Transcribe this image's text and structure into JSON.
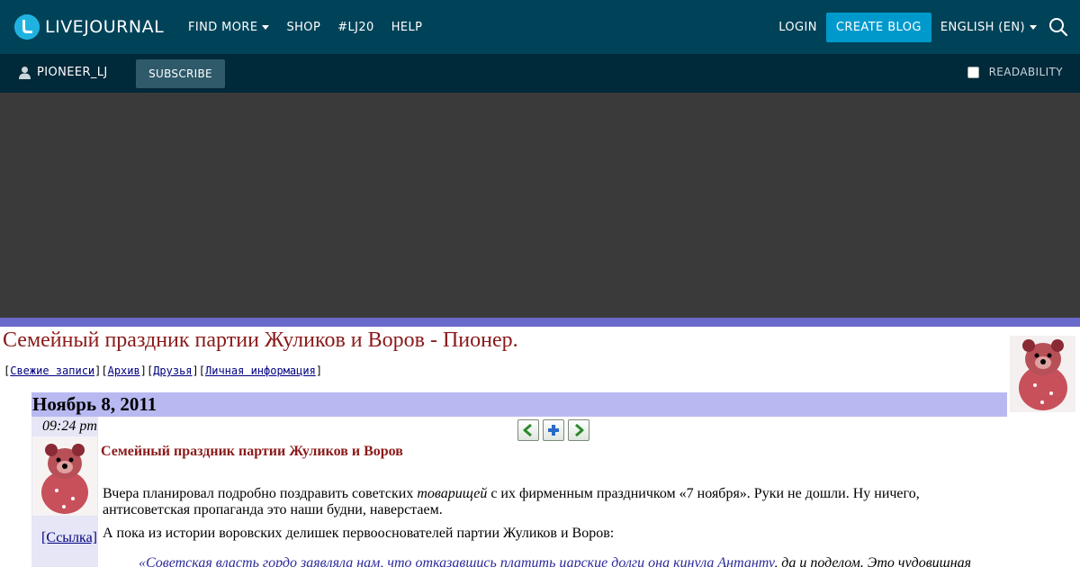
{
  "topbar": {
    "logo_text": "LIVEJOURNAL",
    "nav": [
      {
        "label": "FIND MORE",
        "has_dropdown": true
      },
      {
        "label": "SHOP",
        "has_dropdown": false
      },
      {
        "label": "#LJ20",
        "has_dropdown": false
      },
      {
        "label": "HELP",
        "has_dropdown": false
      }
    ],
    "login_label": "LOGIN",
    "create_blog_label": "CREATE BLOG",
    "language_label": "ENGLISH (EN)",
    "search_icon": "search-icon"
  },
  "subbar": {
    "username": "PIONEER_LJ",
    "subscribe_label": "SUBSCRIBE",
    "readability_label": "READABILITY",
    "readability_checked": false
  },
  "journal": {
    "title": "Семейный праздник партии Жуликов и Воров - Пионер.",
    "nav_links": [
      "Свежие записи",
      "Архив",
      "Друзья",
      "Личная информация"
    ]
  },
  "entry": {
    "date": "Ноябрь 8, 2011",
    "time": "09:24 pm",
    "link_label": "[Ссылка]",
    "subject": "Семейный праздник партии Жуликов и Воров",
    "p1_before": "Вчера планировал подробно поздравить советских ",
    "p1_em": "товарищей",
    "p1_after": " с их фирменным праздничком «7 ноября». Руки не дошли. Ну ничего, антисоветская пропаганда это наши будни, наверстаем.",
    "p2": "А пока из истории воровских делишек первооснователей партии Жуликов и Воров:",
    "quote_link": "«Советская власть гордо заявляла нам, что отказавшись платить царские долги она кинула Антанту",
    "quote_rest": ", да и поделом. Это чудовищная"
  },
  "colors": {
    "topbar_bg": "#004359",
    "subbar_bg": "#00293a",
    "accent": "#0099cc",
    "date_bar": "#b9b9f2",
    "title_red": "#8a1a1a"
  }
}
